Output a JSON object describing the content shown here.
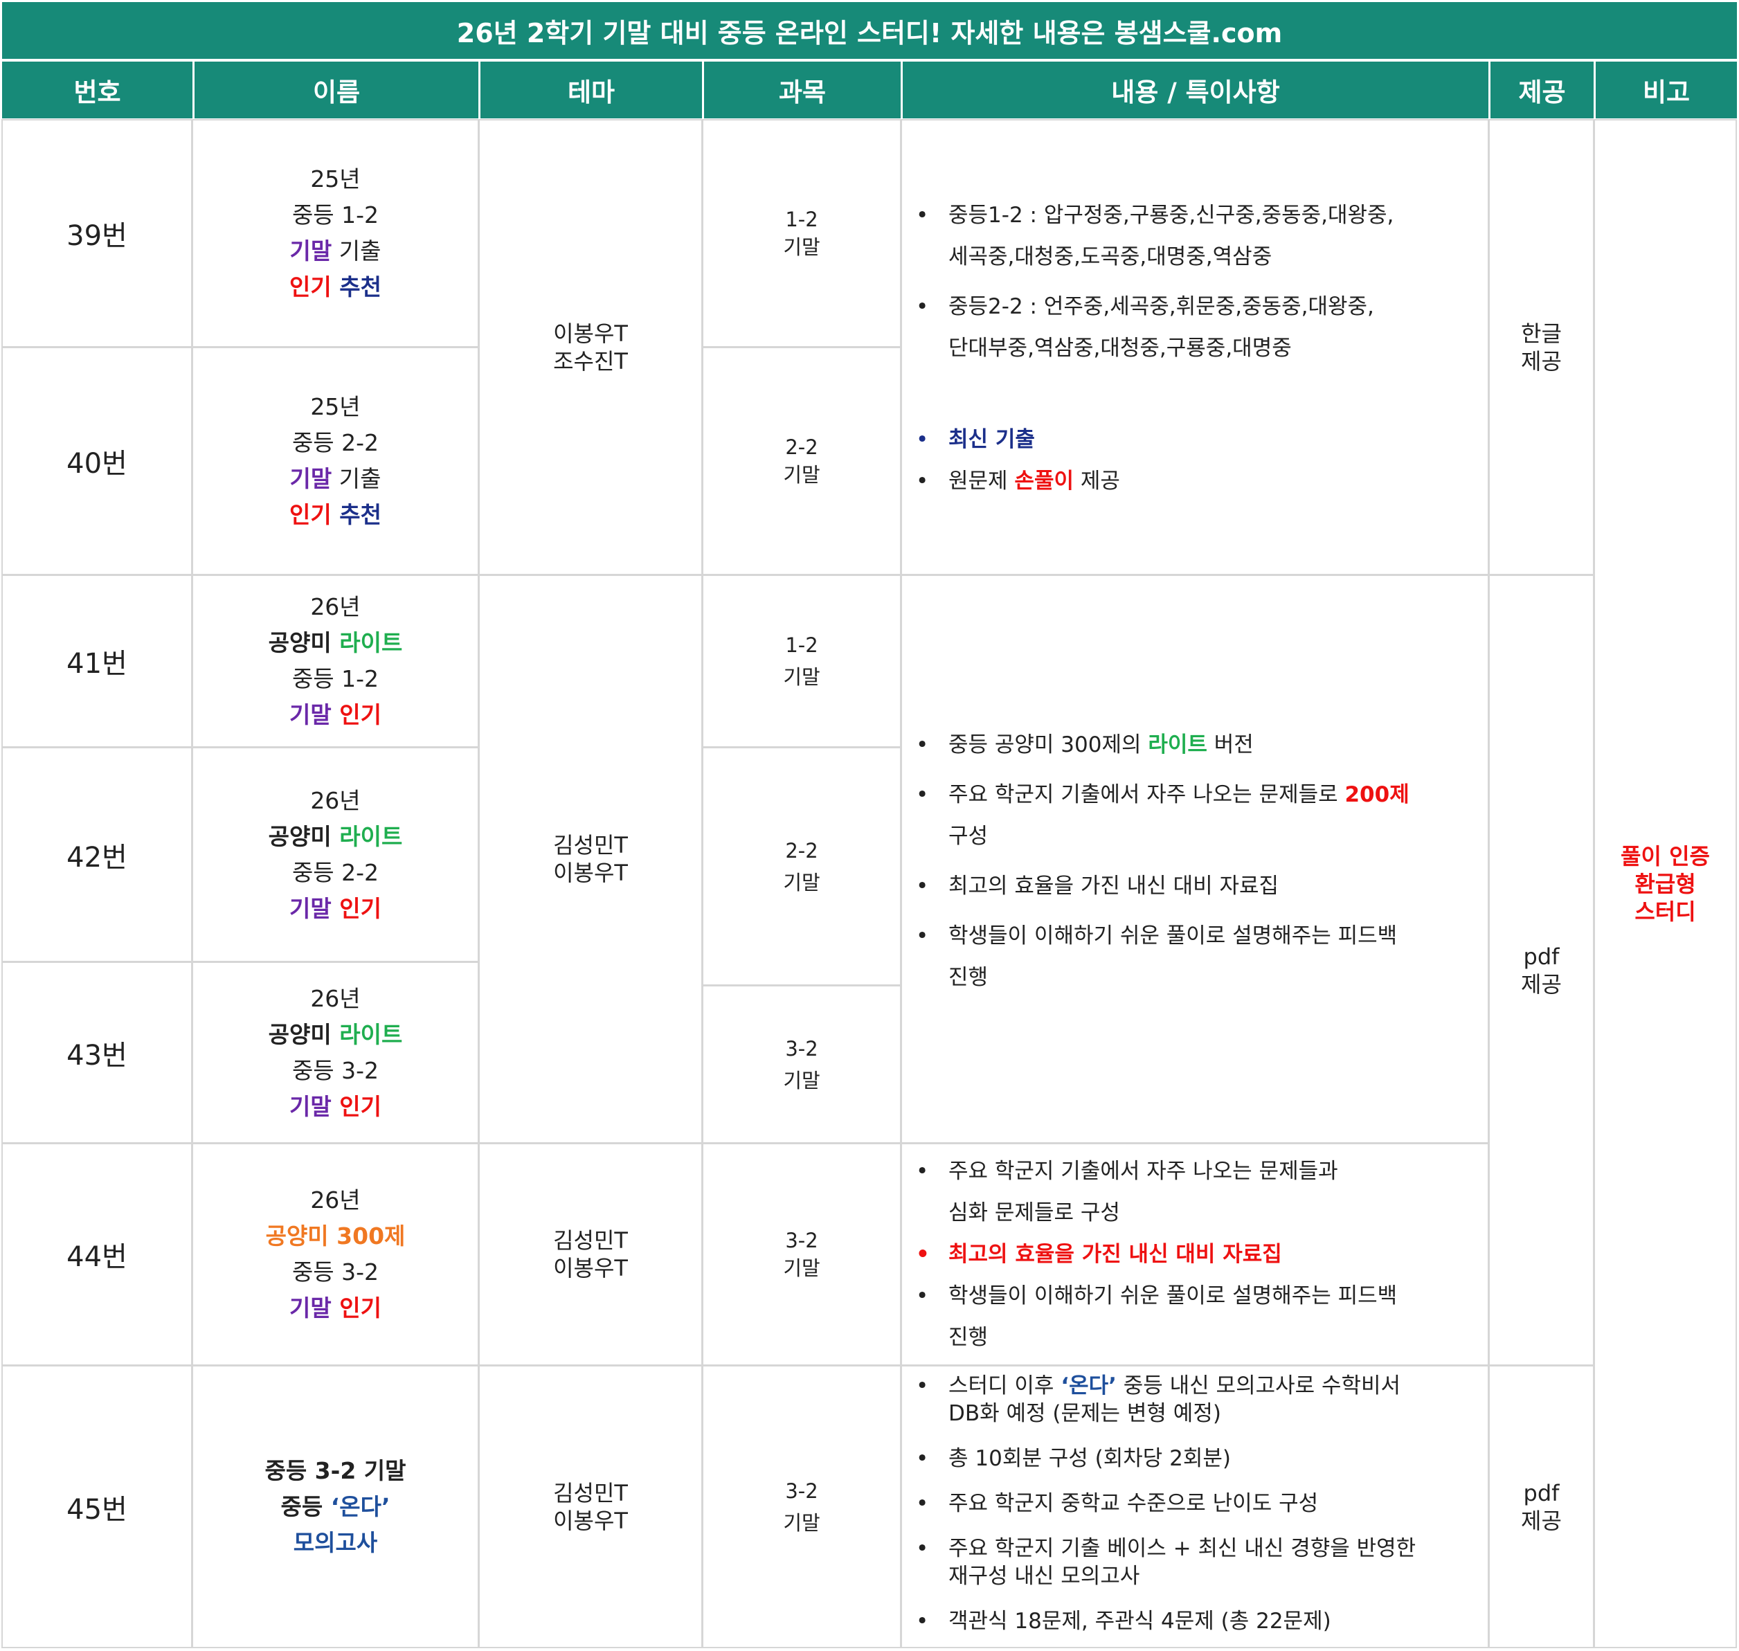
{
  "banner": "26년 2학기 기말 대비 중등 온라인 스터디! 자세한 내용은 봉샘스쿨.com",
  "headers": [
    "번호",
    "이름",
    "테마",
    "과목",
    "내용 / 특이사항",
    "제공",
    "비고"
  ],
  "rows": {
    "r39": {
      "number": "39번",
      "name": {
        "year": "25년",
        "grade": "중등 1-2",
        "exam_a": "기말",
        "exam_b": " 기출",
        "pop_a": "인기",
        "pop_b": " 추천"
      },
      "subject": {
        "line1": "1-2",
        "line2": "기말"
      }
    },
    "r40": {
      "number": "40번",
      "name": {
        "year": "25년",
        "grade": "중등 2-2",
        "exam_a": "기말",
        "exam_b": " 기출",
        "pop_a": "인기",
        "pop_b": " 추천"
      },
      "subject": {
        "line1": "2-2",
        "line2": "기말"
      }
    },
    "r41": {
      "number": "41번",
      "name": {
        "year": "26년",
        "book_a": "공양미 ",
        "book_b": "라이트",
        "grade": "중등 1-2",
        "exam_a": "기말",
        "exam_b": " 인기"
      },
      "subject": {
        "line1": "1-2",
        "line2": "기말"
      }
    },
    "r42": {
      "number": "42번",
      "name": {
        "year": "26년",
        "book_a": "공양미 ",
        "book_b": "라이트",
        "grade": "중등 2-2",
        "exam_a": "기말",
        "exam_b": " 인기"
      },
      "subject": {
        "line1": "2-2",
        "line2": "기말"
      }
    },
    "r43": {
      "number": "43번",
      "name": {
        "year": "26년",
        "book_a": "공양미 ",
        "book_b": "라이트",
        "grade": "중등 3-2",
        "exam_a": "기말",
        "exam_b": " 인기"
      },
      "subject": {
        "line1": "3-2",
        "line2": "기말"
      }
    },
    "r44": {
      "number": "44번",
      "name": {
        "year": "26년",
        "book": "공양미 300제",
        "grade": "중등 3-2",
        "exam_a": "기말",
        "exam_b": " 인기"
      },
      "teacher": {
        "line1": "김성민T",
        "line2": "이봉우T"
      },
      "subject": {
        "line1": "3-2",
        "line2": "기말"
      }
    },
    "r45": {
      "number": "45번",
      "name": {
        "line1": "중등 3-2 기말",
        "line2_a": "중등 ",
        "line2_b": "‘온다’",
        "line3": "모의고사"
      },
      "teacher": {
        "line1": "김성민T",
        "line2": "이봉우T"
      },
      "subject": {
        "line1": "3-2",
        "line2": "기말"
      },
      "provide": {
        "line1": "pdf",
        "line2": "제공"
      }
    }
  },
  "groups": {
    "g1": {
      "teacher": {
        "line1": "이봉우T",
        "line2": "조수진T"
      },
      "provide": {
        "line1": "한글",
        "line2": "제공"
      },
      "content": {
        "b1": "중등1-2 : 압구정중,구룡중,신구중,중동중,대왕중,",
        "b1b": "세곡중,대청중,도곡중,대명중,역삼중",
        "b2": "중등2-2 : 언주중,세곡중,휘문중,중동중,대왕중,",
        "b2b": "단대부중,역삼중,대청중,구룡중,대명중",
        "b3": "최신 기출",
        "b4_a": "원문제 ",
        "b4_b": "손풀이",
        "b4_c": " 제공"
      }
    },
    "g2": {
      "teacher": {
        "line1": "김성민T",
        "line2": "이봉우T"
      },
      "content": {
        "b1_a": "중등 공양미 300제의 ",
        "b1_b": "라이트",
        "b1_c": " 버전",
        "b2_a": "주요 학군지 기출에서 자주 나오는 문제들로 ",
        "b2_b": "200제",
        "b2_c": "구성",
        "b3": "최고의 효율을 가진 내신 대비 자료집",
        "b4_a": "학생들이 이해하기 쉬운 풀이로 설명해주는 피드백",
        "b4_b": "진행"
      }
    },
    "g3": {
      "provide": {
        "line1": "pdf",
        "line2": "제공"
      }
    }
  },
  "content44": {
    "b1_a": "주요 학군지 기출에서 자주 나오는 문제들과",
    "b1_b": "심화 문제들로 구성",
    "b2_a": "최고의 효율",
    "b2_b": "을 가진 내신 대비 자료집",
    "b3_a": "학생들이 이해하기 쉬운 풀이로 설명해주는 피드백",
    "b3_b": "진행"
  },
  "content45": {
    "b1_a": "스터디 이후 ",
    "b1_b": "‘온다’",
    "b1_c": " 중등 내신 모의고사로 수학비서",
    "b1_d": "DB화 예정 (문제는 변형 예정)",
    "b2": "총 10회분 구성 (회차당 2회분)",
    "b3": "주요 학군지 중학교 수준으로 난이도 구성",
    "b4_a": "주요 학군지 기출 베이스 + 최신 내신 경향을 반영한",
    "b4_b": "재구성 내신 모의고사",
    "b5": "객관식 18문제, 주관식 4문제 (총 22문제)"
  },
  "note": {
    "line1": "풀이 인증",
    "line2": "환급형",
    "line3": "스터디"
  },
  "colors": {
    "header_bg": "#178a78",
    "header_text": "#ffffff",
    "border": "#d6d6d6",
    "purple": "#6a28a8",
    "red": "#ee1111",
    "navy": "#1b2f8a",
    "green": "#1fae4f",
    "orange": "#f07822",
    "blue": "#1e4f9c"
  }
}
